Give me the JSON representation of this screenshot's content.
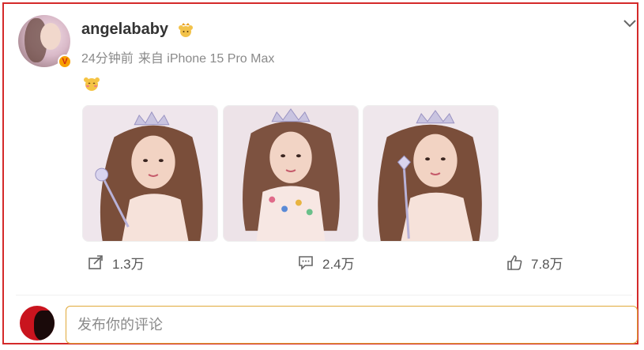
{
  "post": {
    "username": "angelababy",
    "time_ago": "24分钟前",
    "source": "来自 iPhone 15 Pro Max",
    "verified_badge": "V",
    "emoji_icon": "blush-bear-emoji",
    "crown_icon": "crown-bear-icon"
  },
  "photos": [
    {
      "alt_icon": "princess-tiara-photo"
    },
    {
      "alt_icon": "princess-tiara-photo"
    },
    {
      "alt_icon": "princess-wand-photo"
    }
  ],
  "actions": {
    "share_count": "1.3万",
    "comment_count": "2.4万",
    "like_count": "7.8万"
  },
  "comment_box": {
    "placeholder": "发布你的评论"
  },
  "colors": {
    "frame_border": "#d42a2a",
    "input_border": "#e0a93a",
    "muted_text": "#8a8a8a"
  }
}
